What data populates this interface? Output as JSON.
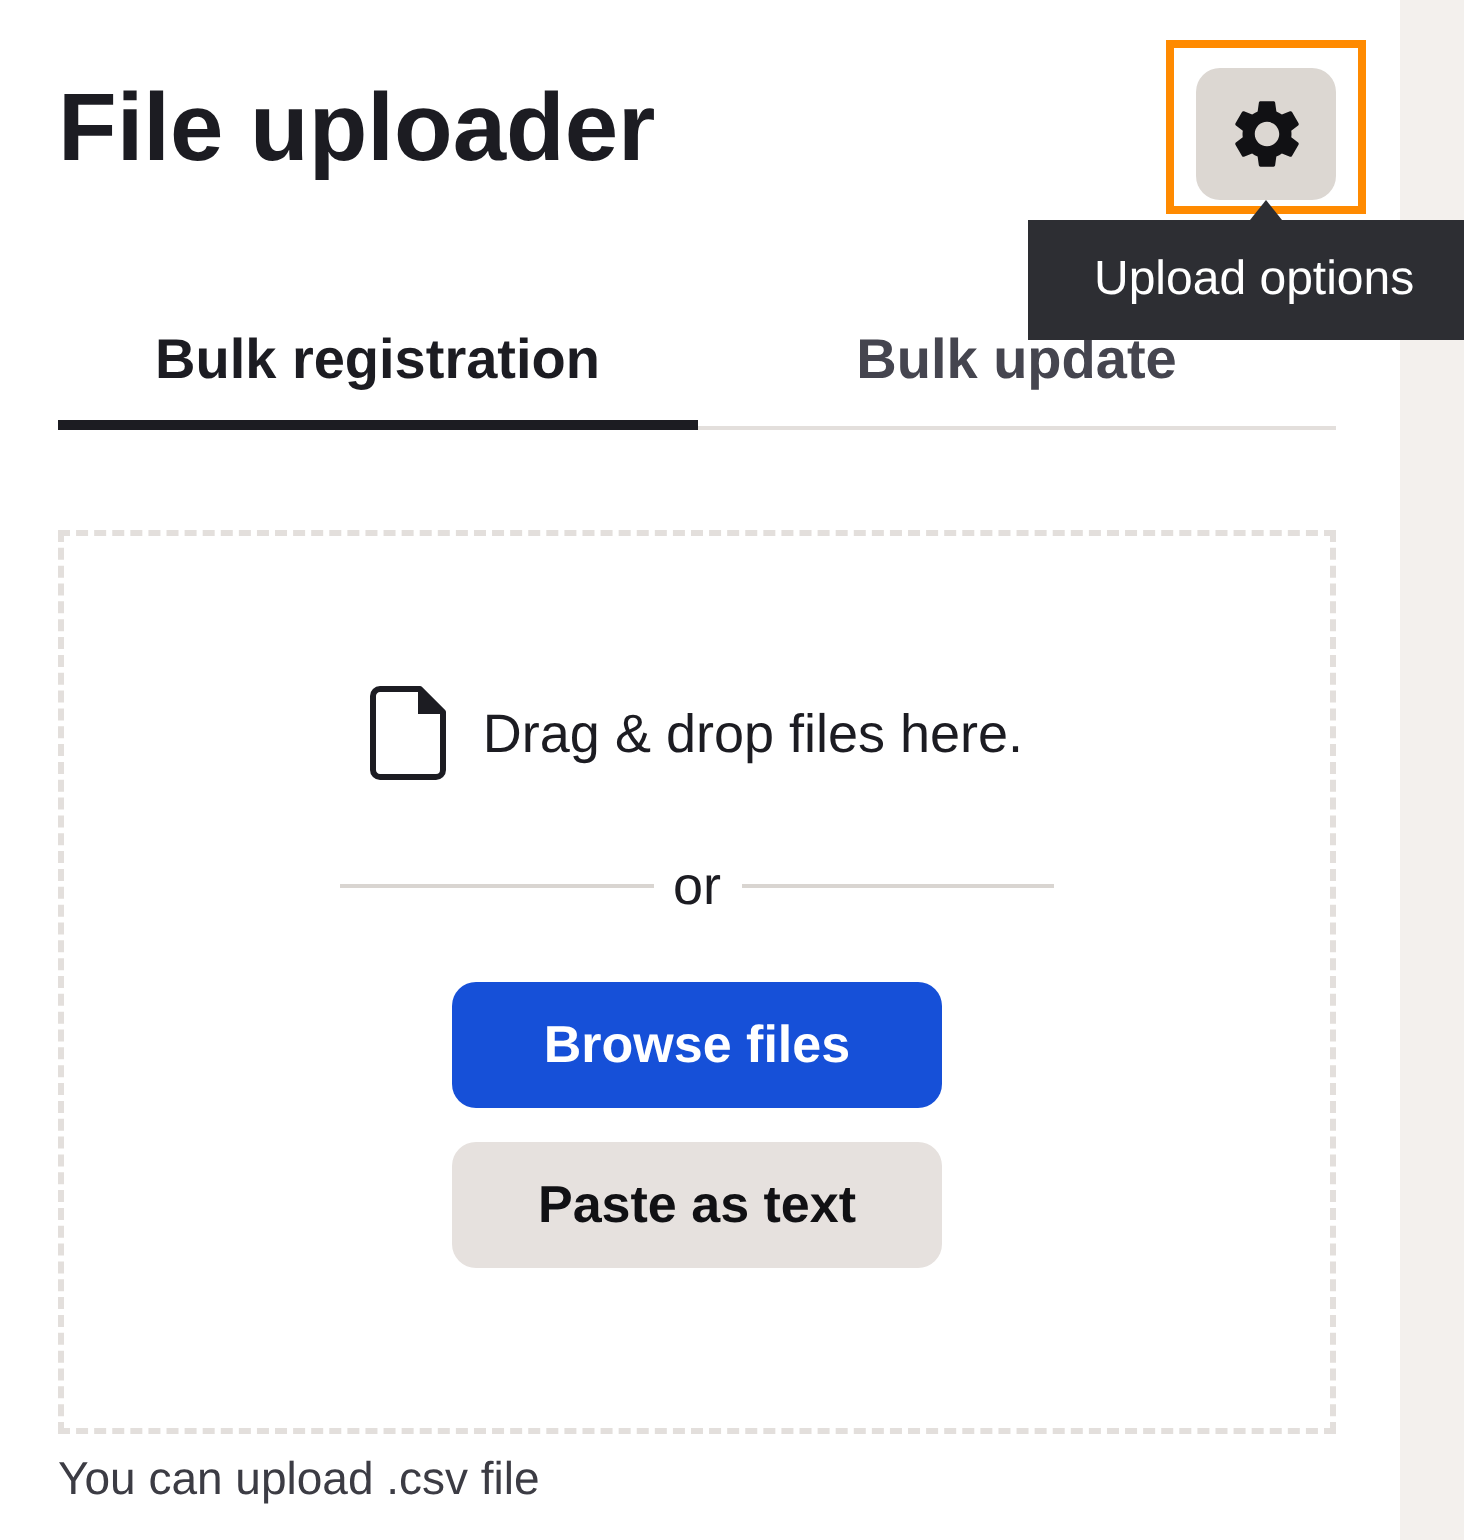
{
  "header": {
    "title": "File uploader",
    "options_button": {
      "focused": true
    },
    "tooltip": "Upload options"
  },
  "tabs": [
    {
      "label": "Bulk registration",
      "selected": true
    },
    {
      "label": "Bulk update",
      "selected": false
    }
  ],
  "dropzone": {
    "prompt": "Drag & drop files here.",
    "divider": "or",
    "buttons": [
      {
        "label": "Browse files",
        "kind": "primary"
      },
      {
        "label": "Paste as text",
        "kind": "secondary"
      }
    ]
  },
  "hint": "You can upload .csv file"
}
